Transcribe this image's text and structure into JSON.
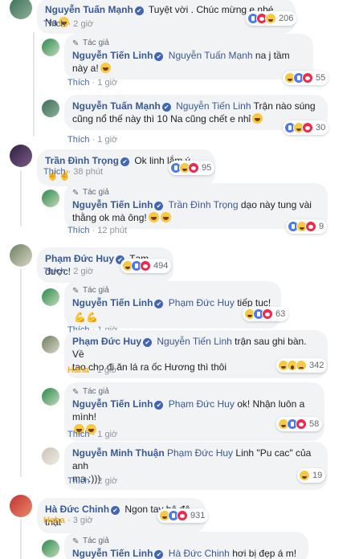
{
  "author_tag": "Tác giả",
  "verified_icon": "✔",
  "comments": [
    {
      "name": "Nguyễn Tuấn Mạnh",
      "text": "Tuyệt vời . Chúc mừng e nhé Na",
      "action": "Thích",
      "time": "2 giờ",
      "reaction_count": "206",
      "reactions": [
        "like",
        "heart",
        "haha"
      ]
    },
    {
      "name": "Nguyễn Tiến Linh",
      "mention": "Nguyễn Tuấn Mạnh",
      "text": "na j tầm này a!",
      "action": "Thích",
      "time": "1 giờ",
      "reaction_count": "55",
      "reactions": [
        "haha",
        "like",
        "heart"
      ]
    },
    {
      "name": "Nguyễn Tuấn Mạnh",
      "mention": "Nguyễn Tiến Linh",
      "text_line1": "Trận nào súng",
      "text_line2": "cũng nổ thế này thì 10 Na cũng chết e nhỉ",
      "action": "Thích",
      "time": "1 giờ",
      "reaction_count": "30",
      "reactions": [
        "like",
        "haha",
        "heart"
      ]
    },
    {
      "name": "Trần Đình Trọng",
      "text": "Ok linh lắm ý",
      "action": "Thích",
      "time": "38 phút",
      "reaction_count": "95",
      "reactions": [
        "like",
        "haha",
        "heart"
      ]
    },
    {
      "name": "Nguyễn Tiến Linh",
      "mention": "Trần Đình Trọng",
      "text_line1": "dạo này tung vài",
      "text_line2": "thằng ok mà ông!",
      "action": "Thích",
      "time": "12 phút",
      "reaction_count": "9",
      "reactions": [
        "like",
        "haha",
        "heart"
      ]
    },
    {
      "name": "Phạm Đức Huy",
      "text": "Tạm được!",
      "action": "Thích",
      "time": "2 giờ",
      "reaction_count": "494",
      "reactions": [
        "haha",
        "like",
        "heart"
      ]
    },
    {
      "name": "Nguyễn Tiến Linh",
      "mention": "Phạm Đức Huy",
      "text": "tiếp tục!",
      "action": "Thích",
      "time": "1 giờ",
      "reaction_count": "63",
      "reactions": [
        "haha",
        "like",
        "heart"
      ]
    },
    {
      "name": "Phạm Đức Huy",
      "mention": "Nguyễn Tiến Linh",
      "text_line1": "trận sau ghi bàn. Về",
      "text_line2": "tao cho đi ăn lá ra ốc Hương thì thôi",
      "action": "Haha",
      "time": "1 giờ",
      "reaction_count": "342",
      "reactions": [
        "haha",
        "wow",
        "sad"
      ]
    },
    {
      "name": "Nguyễn Tiến Linh",
      "mention": "Phạm Đức Huy",
      "text": "ok! Nhận luôn a mình!",
      "action": "Thích",
      "time": "1 giờ",
      "reaction_count": "58",
      "reactions": [
        "haha",
        "like",
        "heart"
      ]
    },
    {
      "name": "Nguyễn Minh Thuận",
      "mention": "Phạm Đức Huy",
      "text_line1": "Linh \"Pu cac\" của anh",
      "text_line2": "ma :)))",
      "action": "Thích",
      "time": "2 giờ",
      "reaction_count": "19",
      "reactions": [
        "haha"
      ]
    },
    {
      "name": "Hà Đức Chinh",
      "text": "Ngon tay bê đê thật",
      "action": "Haha",
      "time": "3 giờ",
      "reaction_count": "931",
      "reactions": [
        "haha",
        "like",
        "heart"
      ]
    },
    {
      "name": "Nguyễn Tiến Linh",
      "mention": "Hà Đức Chinh",
      "text": "hơi bị đẹp á m!",
      "reactions": []
    }
  ]
}
